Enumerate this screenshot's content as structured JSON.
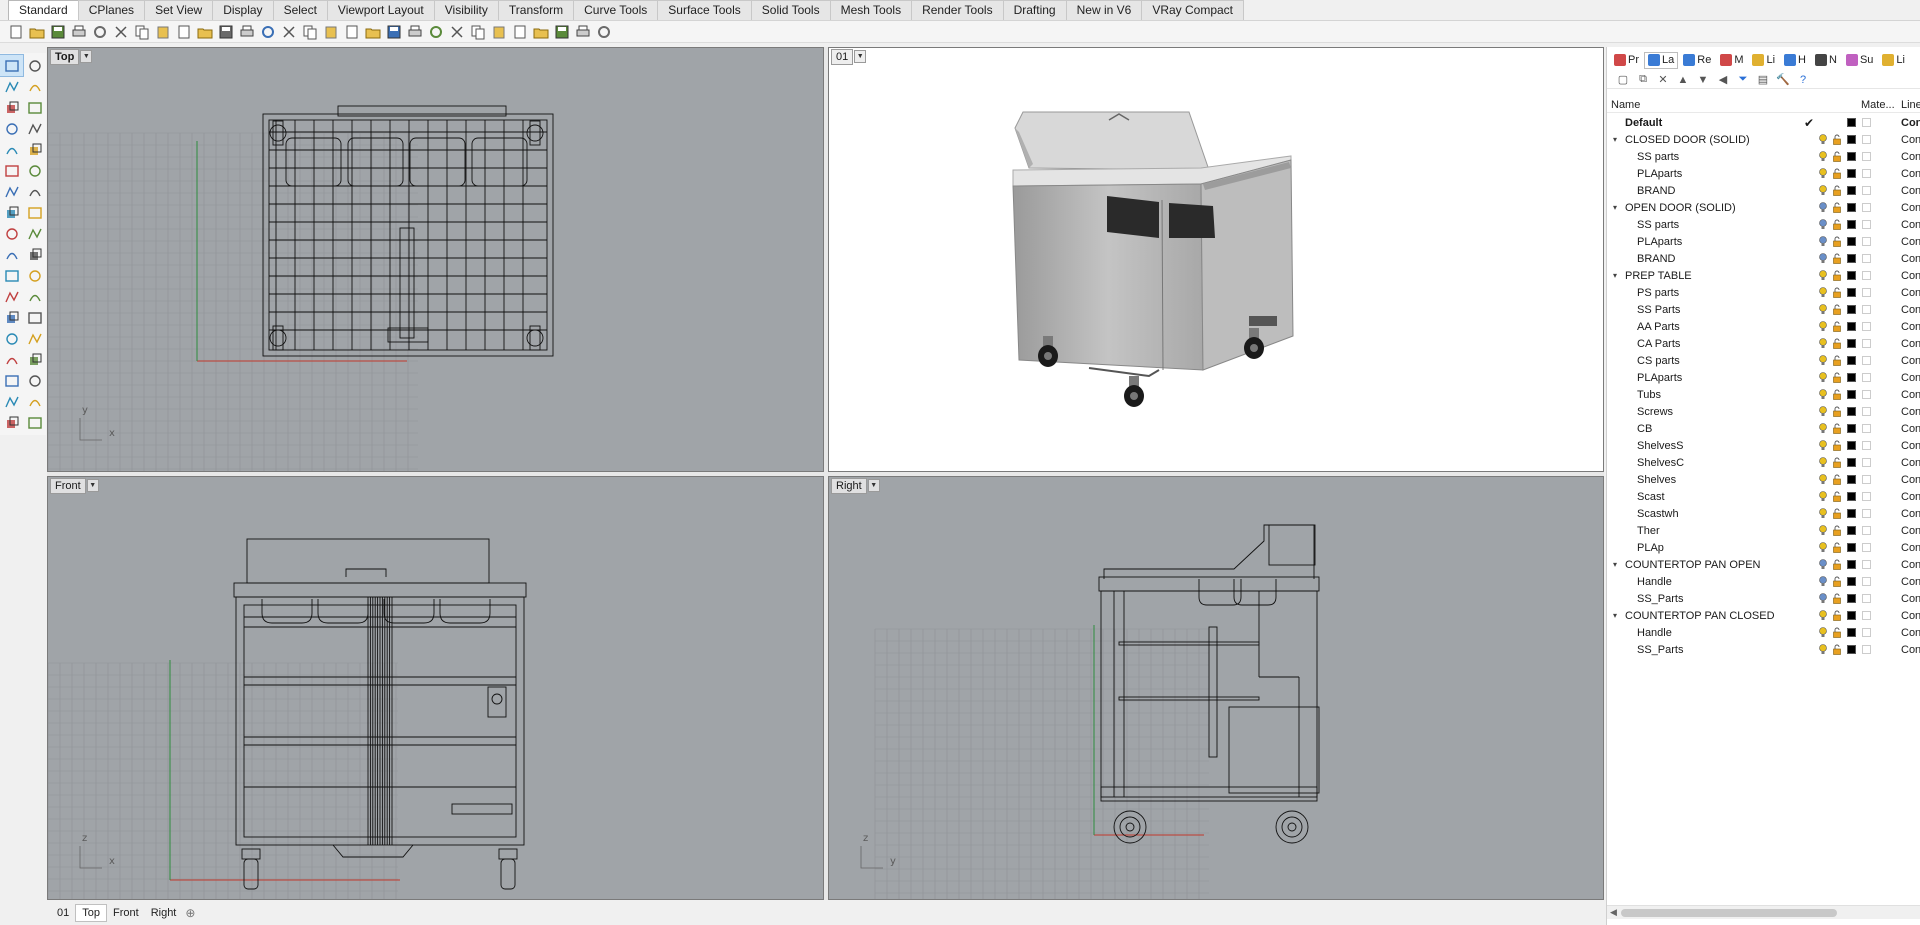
{
  "menu_tabs": [
    {
      "label": "Standard",
      "active": true
    },
    {
      "label": "CPlanes"
    },
    {
      "label": "Set View"
    },
    {
      "label": "Display"
    },
    {
      "label": "Select"
    },
    {
      "label": "Viewport Layout"
    },
    {
      "label": "Visibility"
    },
    {
      "label": "Transform"
    },
    {
      "label": "Curve Tools"
    },
    {
      "label": "Surface Tools"
    },
    {
      "label": "Solid Tools"
    },
    {
      "label": "Mesh Tools"
    },
    {
      "label": "Render Tools"
    },
    {
      "label": "Drafting"
    },
    {
      "label": "New in V6"
    },
    {
      "label": "VRay Compact"
    }
  ],
  "toolbar_icons": [
    "new-file",
    "open-file",
    "save",
    "print",
    "import",
    "cut",
    "copy",
    "paste",
    "undo",
    "pan",
    "move-view",
    "zoom",
    "zoom-window",
    "zoom-extents",
    "zoom-selected",
    "rotate-view",
    "grid",
    "layer",
    "properties",
    "select-points",
    "light",
    "lock",
    "color",
    "render",
    "shaded",
    "material",
    "environment",
    "options",
    "help"
  ],
  "viewports": {
    "top": {
      "title": "Top",
      "axis_a": "y",
      "axis_b": "x"
    },
    "persp": {
      "title": "01"
    },
    "front": {
      "title": "Front",
      "axis_a": "z",
      "axis_b": "x"
    },
    "right": {
      "title": "Right",
      "axis_a": "z",
      "axis_b": "y"
    }
  },
  "viewport_tabs": [
    {
      "label": "01"
    },
    {
      "label": "Top",
      "active": true
    },
    {
      "label": "Front"
    },
    {
      "label": "Right"
    }
  ],
  "panel_tabs": [
    {
      "label": "Pr",
      "color": "#d04848"
    },
    {
      "label": "La",
      "color": "#3a7bd5",
      "active": true
    },
    {
      "label": "Re",
      "color": "#3a7bd5"
    },
    {
      "label": "M",
      "color": "#d04848"
    },
    {
      "label": "Li",
      "color": "#e0b030"
    },
    {
      "label": "H",
      "color": "#3a7bd5"
    },
    {
      "label": "N",
      "color": "#444444"
    },
    {
      "label": "Su",
      "color": "#c060c0"
    },
    {
      "label": "Li",
      "color": "#e0b030"
    }
  ],
  "layers_header": {
    "name": "Name",
    "material": "Mate...",
    "linetype": "Line"
  },
  "layers": [
    {
      "name": "Default",
      "level": 0,
      "bold": true,
      "current": true,
      "linetype": "Con"
    },
    {
      "name": "CLOSED DOOR (SOLID)",
      "level": 0,
      "expanded": true,
      "linetype": "Con"
    },
    {
      "name": "SS parts",
      "level": 1,
      "linetype": "Con"
    },
    {
      "name": "PLAparts",
      "level": 1,
      "linetype": "Con"
    },
    {
      "name": "BRAND",
      "level": 1,
      "linetype": "Con"
    },
    {
      "name": "OPEN DOOR (SOLID)",
      "level": 0,
      "expanded": true,
      "off": true,
      "linetype": "Con"
    },
    {
      "name": "SS parts",
      "level": 1,
      "off": true,
      "linetype": "Con"
    },
    {
      "name": "PLAparts",
      "level": 1,
      "off": true,
      "linetype": "Con"
    },
    {
      "name": "BRAND",
      "level": 1,
      "off": true,
      "linetype": "Con"
    },
    {
      "name": "PREP TABLE",
      "level": 0,
      "expanded": true,
      "linetype": "Con"
    },
    {
      "name": "PS parts",
      "level": 1,
      "linetype": "Con"
    },
    {
      "name": "SS Parts",
      "level": 1,
      "linetype": "Con"
    },
    {
      "name": "AA Parts",
      "level": 1,
      "linetype": "Con"
    },
    {
      "name": "CA Parts",
      "level": 1,
      "linetype": "Con"
    },
    {
      "name": "CS parts",
      "level": 1,
      "linetype": "Con"
    },
    {
      "name": "PLAparts",
      "level": 1,
      "linetype": "Con"
    },
    {
      "name": "Tubs",
      "level": 1,
      "linetype": "Con"
    },
    {
      "name": "Screws",
      "level": 1,
      "linetype": "Con"
    },
    {
      "name": "CB",
      "level": 1,
      "linetype": "Con"
    },
    {
      "name": "ShelvesS",
      "level": 1,
      "linetype": "Con"
    },
    {
      "name": "ShelvesC",
      "level": 1,
      "linetype": "Con"
    },
    {
      "name": "Shelves",
      "level": 1,
      "linetype": "Con"
    },
    {
      "name": "Scast",
      "level": 1,
      "linetype": "Con"
    },
    {
      "name": "Scastwh",
      "level": 1,
      "linetype": "Con"
    },
    {
      "name": "Ther",
      "level": 1,
      "linetype": "Con"
    },
    {
      "name": "PLAp",
      "level": 1,
      "linetype": "Con"
    },
    {
      "name": "COUNTERTOP PAN OPEN",
      "level": 0,
      "expanded": true,
      "off": true,
      "linetype": "Con"
    },
    {
      "name": "Handle",
      "level": 1,
      "off": true,
      "linetype": "Con"
    },
    {
      "name": "SS_Parts",
      "level": 1,
      "off": true,
      "linetype": "Con"
    },
    {
      "name": "COUNTERTOP PAN CLOSED",
      "level": 0,
      "expanded": true,
      "linetype": "Con"
    },
    {
      "name": "Handle",
      "level": 1,
      "linetype": "Con"
    },
    {
      "name": "SS_Parts",
      "level": 1,
      "linetype": "Con"
    }
  ],
  "colors": {
    "viewport_bg": "#a0a4a8",
    "grid": "#8f9397",
    "x_axis": "#c0392b",
    "y_axis": "#2e8b3e",
    "bulb_on": "#e8c020",
    "bulb_off": "#6a8fc8",
    "lock": "#e8a020"
  }
}
